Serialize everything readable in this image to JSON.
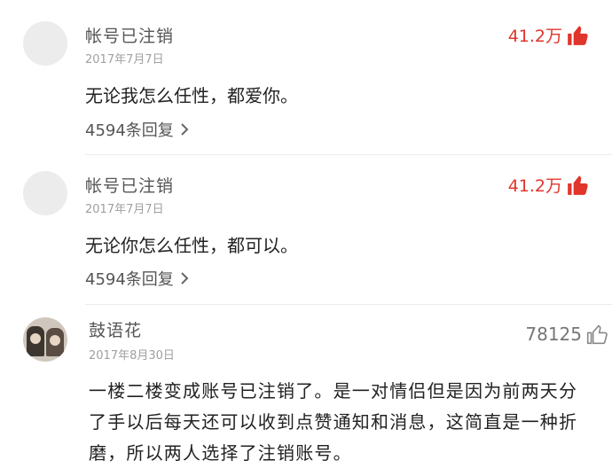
{
  "comments": [
    {
      "author": "帐号已注销",
      "date": "2017年7月7日",
      "likes": "41.2万",
      "content": "无论我怎么任性，都爱你。",
      "replies": "4594条回复"
    },
    {
      "author": "帐号已注销",
      "date": "2017年7月7日",
      "likes": "41.2万",
      "content": "无论你怎么任性，都可以。",
      "replies": "4594条回复"
    },
    {
      "author": "鼓语花",
      "date": "2017年8月30日",
      "likes": "78125",
      "content": "一楼二楼变成账号已注销了。是一对情侣但是因为前两天分了手以后每天还可以收到点赞通知和消息，这简直是一种折磨，所以两人选择了注销账号。"
    }
  ],
  "colors": {
    "hot_like": "#e0352b",
    "like_gray": "#777777"
  },
  "icons": {
    "like": "thumbs-up-icon",
    "reply_arrow": "chevron-right-icon"
  }
}
